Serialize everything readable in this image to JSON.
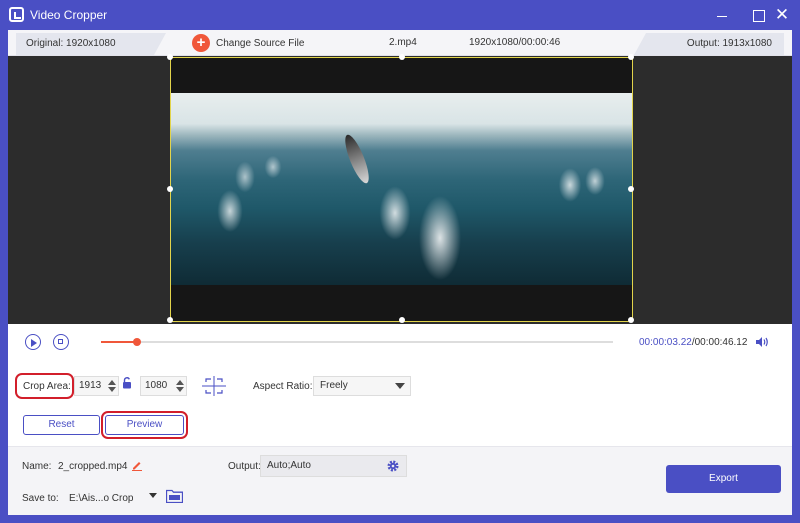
{
  "window": {
    "title": "Video Cropper",
    "icons": [
      "app-crop-icon",
      "minimize-icon",
      "maximize-icon",
      "close-icon"
    ]
  },
  "info_bar": {
    "original": "Original: 1920x1080",
    "change_source_label": "Change Source File",
    "file_name": "2.mp4",
    "file_meta": "1920x1080/00:00:46",
    "output": "Output: 1913x1080"
  },
  "player": {
    "current_time": "00:00:03.22",
    "total_time": "/00:00:46.12",
    "progress_fraction": 0.0698,
    "icons": [
      "play-icon",
      "stop-icon",
      "volume-icon"
    ]
  },
  "crop": {
    "label": "Crop Area:",
    "width": "1913",
    "height": "1080",
    "aspect_label": "Aspect Ratio:",
    "aspect_value": "Freely",
    "icons": [
      "lock-icon",
      "center-crop-icon"
    ]
  },
  "buttons": {
    "reset": "Reset",
    "preview": "Preview",
    "export": "Export"
  },
  "output_settings": {
    "name_label": "Name:",
    "name_value": "2_cropped.mp4",
    "output_label": "Output:",
    "output_value": "Auto;Auto",
    "save_label": "Save to:",
    "save_value": "E:\\Ais...o Crop",
    "icons": [
      "pen-icon",
      "gear-icon",
      "folder-icon"
    ]
  },
  "colors": {
    "accent": "#4a4fc4",
    "orange": "#f0573a",
    "highlight_red": "#d21f2b",
    "crop_border": "#e2d44b"
  }
}
